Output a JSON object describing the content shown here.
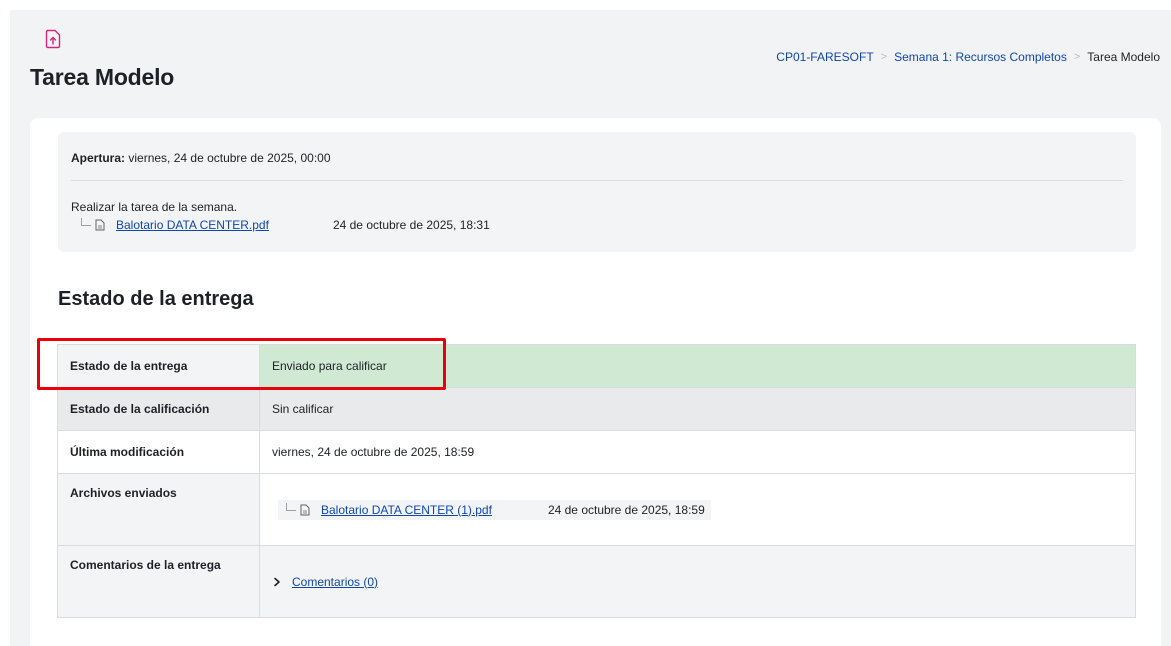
{
  "header": {
    "title": "Tarea Modelo",
    "breadcrumb": [
      {
        "label": "CP01-FARESOFT"
      },
      {
        "label": "Semana 1: Recursos Completos"
      },
      {
        "label": "Tarea Modelo"
      }
    ]
  },
  "intro": {
    "opening_label": "Apertura:",
    "opening_value": "viernes, 24 de octubre de 2025, 00:00",
    "description": "Realizar la tarea de la semana.",
    "attachment": {
      "name": "Balotario DATA CENTER.pdf",
      "date": "24 de octubre de 2025, 18:31"
    }
  },
  "submission": {
    "section_title": "Estado de la entrega",
    "rows": [
      {
        "label": "Estado de la entrega",
        "value": "Enviado para calificar"
      },
      {
        "label": "Estado de la calificación",
        "value": "Sin calificar"
      },
      {
        "label": "Última modificación",
        "value": "viernes, 24 de octubre de 2025, 18:59"
      },
      {
        "label": "Archivos enviados",
        "file": {
          "name": "Balotario DATA CENTER (1).pdf",
          "date": "24 de octubre de 2025, 18:59"
        }
      },
      {
        "label": "Comentarios de la entrega",
        "comments_link": "Comentarios (0)"
      }
    ]
  },
  "colors": {
    "accent": "#0f47ad",
    "submitted_bg": "#cfe9d2",
    "highlight": "#e8000b",
    "activity_icon": "#d8257a"
  },
  "icons": {
    "activity": "assignment-upload-icon",
    "file": "pdf-file-icon",
    "expand": "chevron-right-icon"
  }
}
